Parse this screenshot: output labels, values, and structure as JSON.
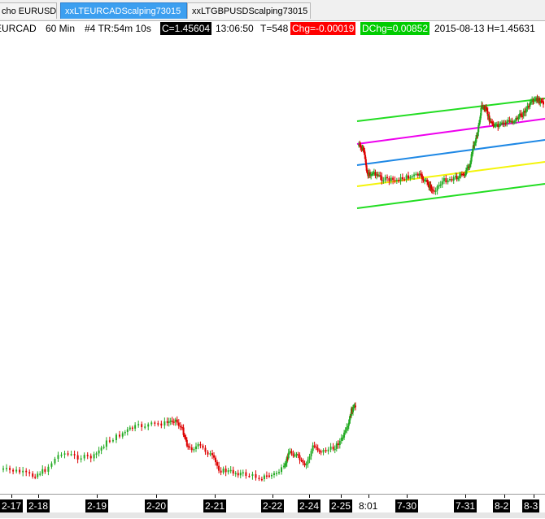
{
  "tabs": [
    {
      "label": "cho EURUSD",
      "active": false
    },
    {
      "label": "xxLTEURCADScalping73015",
      "active": true
    },
    {
      "label": "xxLTGBPUSDScalping73015",
      "active": false
    }
  ],
  "infobar": {
    "symbol": "EURCAD",
    "interval": "60 Min",
    "bar_info": "#4 TR:54m 10s",
    "close": "C=1.45604",
    "time": "13:06:50",
    "ticks": "T=548",
    "change": "Chg=-0.00019",
    "dchange": "DChg=0.00852",
    "date_high": "2015-08-13 H=1.45631"
  },
  "colors": {
    "up_candle": "#22aa22",
    "down_candle": "#dd0000",
    "channel_outer": "#22dd22",
    "channel_inner_top": "#ee00ee",
    "channel_mid": "#1e88e5",
    "channel_inner_bottom": "#f4f40a",
    "change_bg": "#ff0000",
    "dchange_bg": "#00cc00"
  },
  "xaxis": {
    "labels": [
      "2-17",
      "2-18",
      "2-19",
      "2-20",
      "2-21",
      "2-22",
      "2-24",
      "2-25",
      "8:01",
      "7-30",
      "7-31",
      "8-2",
      "8-3"
    ],
    "boxed": [
      true,
      true,
      true,
      true,
      true,
      true,
      true,
      true,
      false,
      true,
      true,
      true,
      true
    ]
  }
}
